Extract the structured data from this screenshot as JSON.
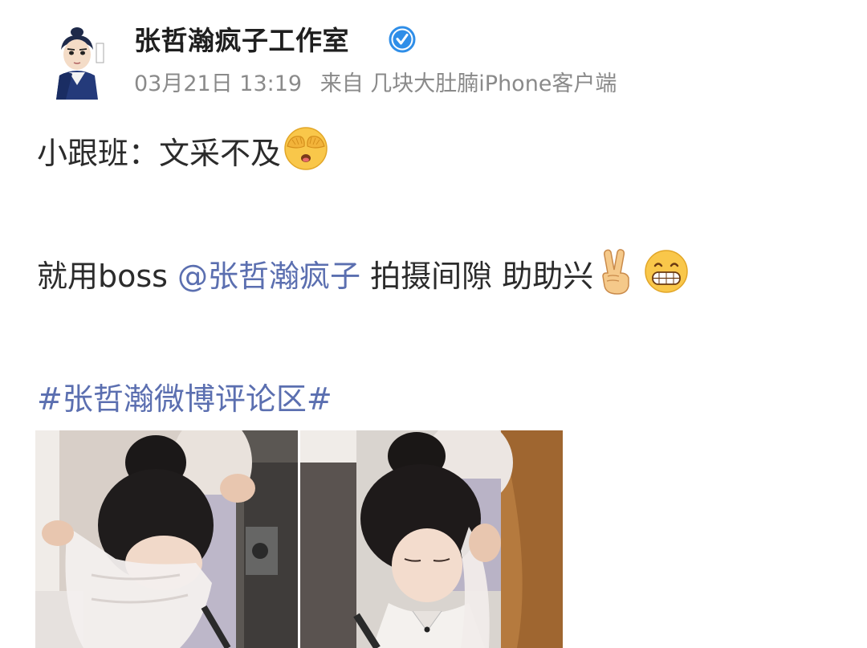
{
  "post": {
    "author": "张哲瀚疯子工作室",
    "timestamp": "03月21日 13:19",
    "source": "来自 几块大肚腩iPhone客户端",
    "line1_text": "小跟班：文采不及",
    "line2_prefix": "就用boss ",
    "line2_mention": "@张哲瀚疯子",
    "line2_suffix": " 拍摄间隙  助助兴",
    "hashtag": "#张哲瀚微博评论区#"
  },
  "icons": {
    "verified": "verified-badge-icon",
    "emoji1": "see-no-evil-face-icon",
    "emoji2": "victory-hand-icon",
    "emoji3": "grinning-face-icon"
  },
  "colors": {
    "link": "#5b6fb0",
    "meta": "#8a8a8a",
    "text": "#2b2b2b",
    "verified": "#2f8ee8"
  }
}
